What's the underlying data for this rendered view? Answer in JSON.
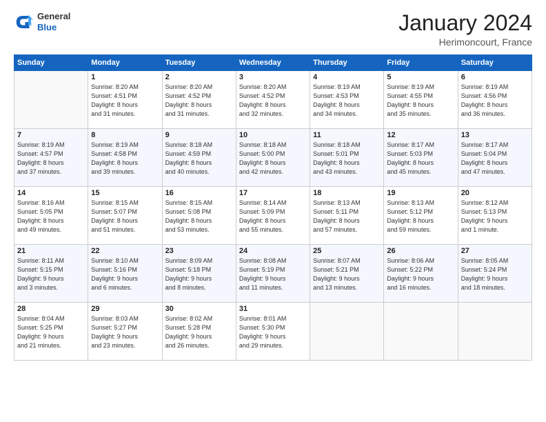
{
  "logo": {
    "general": "General",
    "blue": "Blue"
  },
  "title": "January 2024",
  "location": "Herimoncourt, France",
  "days_of_week": [
    "Sunday",
    "Monday",
    "Tuesday",
    "Wednesday",
    "Thursday",
    "Friday",
    "Saturday"
  ],
  "weeks": [
    [
      {
        "num": "",
        "sunrise": "",
        "sunset": "",
        "daylight": ""
      },
      {
        "num": "1",
        "sunrise": "Sunrise: 8:20 AM",
        "sunset": "Sunset: 4:51 PM",
        "daylight": "Daylight: 8 hours and 31 minutes."
      },
      {
        "num": "2",
        "sunrise": "Sunrise: 8:20 AM",
        "sunset": "Sunset: 4:52 PM",
        "daylight": "Daylight: 8 hours and 31 minutes."
      },
      {
        "num": "3",
        "sunrise": "Sunrise: 8:20 AM",
        "sunset": "Sunset: 4:52 PM",
        "daylight": "Daylight: 8 hours and 32 minutes."
      },
      {
        "num": "4",
        "sunrise": "Sunrise: 8:19 AM",
        "sunset": "Sunset: 4:53 PM",
        "daylight": "Daylight: 8 hours and 34 minutes."
      },
      {
        "num": "5",
        "sunrise": "Sunrise: 8:19 AM",
        "sunset": "Sunset: 4:55 PM",
        "daylight": "Daylight: 8 hours and 35 minutes."
      },
      {
        "num": "6",
        "sunrise": "Sunrise: 8:19 AM",
        "sunset": "Sunset: 4:56 PM",
        "daylight": "Daylight: 8 hours and 36 minutes."
      }
    ],
    [
      {
        "num": "7",
        "sunrise": "Sunrise: 8:19 AM",
        "sunset": "Sunset: 4:57 PM",
        "daylight": "Daylight: 8 hours and 37 minutes."
      },
      {
        "num": "8",
        "sunrise": "Sunrise: 8:19 AM",
        "sunset": "Sunset: 4:58 PM",
        "daylight": "Daylight: 8 hours and 39 minutes."
      },
      {
        "num": "9",
        "sunrise": "Sunrise: 8:18 AM",
        "sunset": "Sunset: 4:59 PM",
        "daylight": "Daylight: 8 hours and 40 minutes."
      },
      {
        "num": "10",
        "sunrise": "Sunrise: 8:18 AM",
        "sunset": "Sunset: 5:00 PM",
        "daylight": "Daylight: 8 hours and 42 minutes."
      },
      {
        "num": "11",
        "sunrise": "Sunrise: 8:18 AM",
        "sunset": "Sunset: 5:01 PM",
        "daylight": "Daylight: 8 hours and 43 minutes."
      },
      {
        "num": "12",
        "sunrise": "Sunrise: 8:17 AM",
        "sunset": "Sunset: 5:03 PM",
        "daylight": "Daylight: 8 hours and 45 minutes."
      },
      {
        "num": "13",
        "sunrise": "Sunrise: 8:17 AM",
        "sunset": "Sunset: 5:04 PM",
        "daylight": "Daylight: 8 hours and 47 minutes."
      }
    ],
    [
      {
        "num": "14",
        "sunrise": "Sunrise: 8:16 AM",
        "sunset": "Sunset: 5:05 PM",
        "daylight": "Daylight: 8 hours and 49 minutes."
      },
      {
        "num": "15",
        "sunrise": "Sunrise: 8:15 AM",
        "sunset": "Sunset: 5:07 PM",
        "daylight": "Daylight: 8 hours and 51 minutes."
      },
      {
        "num": "16",
        "sunrise": "Sunrise: 8:15 AM",
        "sunset": "Sunset: 5:08 PM",
        "daylight": "Daylight: 8 hours and 53 minutes."
      },
      {
        "num": "17",
        "sunrise": "Sunrise: 8:14 AM",
        "sunset": "Sunset: 5:09 PM",
        "daylight": "Daylight: 8 hours and 55 minutes."
      },
      {
        "num": "18",
        "sunrise": "Sunrise: 8:13 AM",
        "sunset": "Sunset: 5:11 PM",
        "daylight": "Daylight: 8 hours and 57 minutes."
      },
      {
        "num": "19",
        "sunrise": "Sunrise: 8:13 AM",
        "sunset": "Sunset: 5:12 PM",
        "daylight": "Daylight: 8 hours and 59 minutes."
      },
      {
        "num": "20",
        "sunrise": "Sunrise: 8:12 AM",
        "sunset": "Sunset: 5:13 PM",
        "daylight": "Daylight: 9 hours and 1 minute."
      }
    ],
    [
      {
        "num": "21",
        "sunrise": "Sunrise: 8:11 AM",
        "sunset": "Sunset: 5:15 PM",
        "daylight": "Daylight: 9 hours and 3 minutes."
      },
      {
        "num": "22",
        "sunrise": "Sunrise: 8:10 AM",
        "sunset": "Sunset: 5:16 PM",
        "daylight": "Daylight: 9 hours and 6 minutes."
      },
      {
        "num": "23",
        "sunrise": "Sunrise: 8:09 AM",
        "sunset": "Sunset: 5:18 PM",
        "daylight": "Daylight: 9 hours and 8 minutes."
      },
      {
        "num": "24",
        "sunrise": "Sunrise: 8:08 AM",
        "sunset": "Sunset: 5:19 PM",
        "daylight": "Daylight: 9 hours and 11 minutes."
      },
      {
        "num": "25",
        "sunrise": "Sunrise: 8:07 AM",
        "sunset": "Sunset: 5:21 PM",
        "daylight": "Daylight: 9 hours and 13 minutes."
      },
      {
        "num": "26",
        "sunrise": "Sunrise: 8:06 AM",
        "sunset": "Sunset: 5:22 PM",
        "daylight": "Daylight: 9 hours and 16 minutes."
      },
      {
        "num": "27",
        "sunrise": "Sunrise: 8:05 AM",
        "sunset": "Sunset: 5:24 PM",
        "daylight": "Daylight: 9 hours and 18 minutes."
      }
    ],
    [
      {
        "num": "28",
        "sunrise": "Sunrise: 8:04 AM",
        "sunset": "Sunset: 5:25 PM",
        "daylight": "Daylight: 9 hours and 21 minutes."
      },
      {
        "num": "29",
        "sunrise": "Sunrise: 8:03 AM",
        "sunset": "Sunset: 5:27 PM",
        "daylight": "Daylight: 9 hours and 23 minutes."
      },
      {
        "num": "30",
        "sunrise": "Sunrise: 8:02 AM",
        "sunset": "Sunset: 5:28 PM",
        "daylight": "Daylight: 9 hours and 26 minutes."
      },
      {
        "num": "31",
        "sunrise": "Sunrise: 8:01 AM",
        "sunset": "Sunset: 5:30 PM",
        "daylight": "Daylight: 9 hours and 29 minutes."
      },
      {
        "num": "",
        "sunrise": "",
        "sunset": "",
        "daylight": ""
      },
      {
        "num": "",
        "sunrise": "",
        "sunset": "",
        "daylight": ""
      },
      {
        "num": "",
        "sunrise": "",
        "sunset": "",
        "daylight": ""
      }
    ]
  ]
}
